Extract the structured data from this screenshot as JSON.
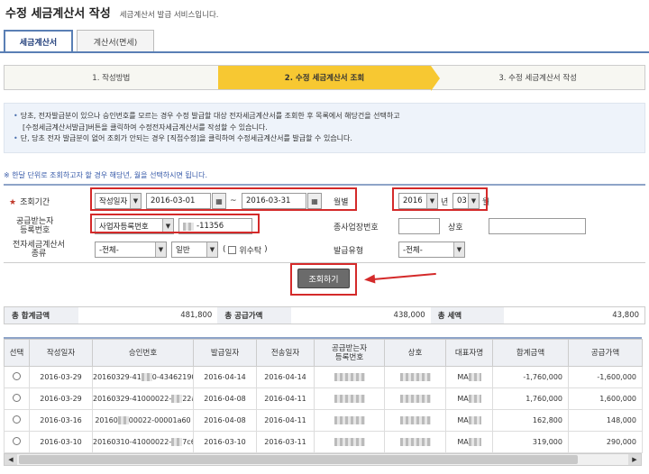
{
  "header": {
    "title": "수정 세금계산서 작성",
    "subtitle": "세금계산서 발급 서비스입니다."
  },
  "tabs": [
    {
      "label": "세금계산서",
      "active": true
    },
    {
      "label": "계산서(면세)",
      "active": false
    }
  ],
  "steps": [
    {
      "label": "1. 작성방법"
    },
    {
      "label": "2. 수정 세금계산서 조회"
    },
    {
      "label": "3. 수정 세금계산서 작성"
    }
  ],
  "notice": {
    "line1": "당초, 전자발급분이 있으나 승인번호를 모르는 경우 수정 발급할 대상 전자세금계산서를 조회한 후 목록에서 해당건을 선택하고",
    "line2": "[수정세금계산서발급]버튼을 클릭하여 수정전자세금계산서를 작성할 수 있습니다.",
    "line3": "단, 당초 전자 발급분이 없어 조회가 안되는 경우 [직접수정]을 클릭하여 수정세금계산서를 발급할 수 있습니다."
  },
  "hint": "※ 한달 단위로 조회하고자 할 경우 해당년, 월을 선택하시면 됩니다.",
  "form": {
    "period_label": "조회기간",
    "date_type": "작성일자",
    "start_date": "2016-03-01",
    "tilde": "~",
    "end_date": "2016-03-31",
    "monthly_label": "월별",
    "year": "2016",
    "year_unit": "년",
    "month": "03",
    "month_unit": "월",
    "supplier_label_1": "공급받는자",
    "supplier_label_2": "등록번호",
    "supplier_type": "사업자등록번호",
    "supplier_number": "-11356",
    "branch_label": "종사업장번호",
    "company_label": "상호",
    "etax_label_1": "전자세금계산서",
    "etax_label_2": "종류",
    "etax_kind": "-전체-",
    "etax_sub": "일반",
    "trust_label": "위수탁",
    "issue_type_label": "발급유형",
    "issue_type": "-전체-"
  },
  "actions": {
    "search_label": "조회하기"
  },
  "totals": {
    "sum_label": "총 합계금액",
    "sum_value": "481,800",
    "supply_label": "총 공급가액",
    "supply_value": "438,000",
    "tax_label": "총 세액",
    "tax_value": "43,800"
  },
  "table": {
    "headers": [
      "선택",
      "작성일자",
      "승인번호",
      "발급일자",
      "전송일자",
      "공급받는자\n등록번호",
      "상호",
      "대표자명",
      "합계금액",
      "공급가액"
    ],
    "rows": [
      {
        "write_date": "2016-03-29",
        "approval": "20160329-41",
        "approval_tail": "0-43462190",
        "issue_date": "2016-04-14",
        "send_date": "2016-04-14",
        "rep": "MA",
        "total": "-1,760,000",
        "supply": "-1,600,000"
      },
      {
        "write_date": "2016-03-29",
        "approval": "20160329-41000022-",
        "approval_tail": "22a5",
        "issue_date": "2016-04-08",
        "send_date": "2016-04-11",
        "rep": "MA",
        "total": "1,760,000",
        "supply": "1,600,000"
      },
      {
        "write_date": "2016-03-16",
        "approval": "20160",
        "approval_tail": "00022-00001a60",
        "issue_date": "2016-04-08",
        "send_date": "2016-04-11",
        "rep": "MA",
        "total": "162,800",
        "supply": "148,000"
      },
      {
        "write_date": "2016-03-10",
        "approval": "20160310-41000022-",
        "approval_tail": "7c6",
        "issue_date": "2016-03-10",
        "send_date": "2016-03-11",
        "rep": "MA",
        "total": "319,000",
        "supply": "290,000"
      }
    ]
  }
}
